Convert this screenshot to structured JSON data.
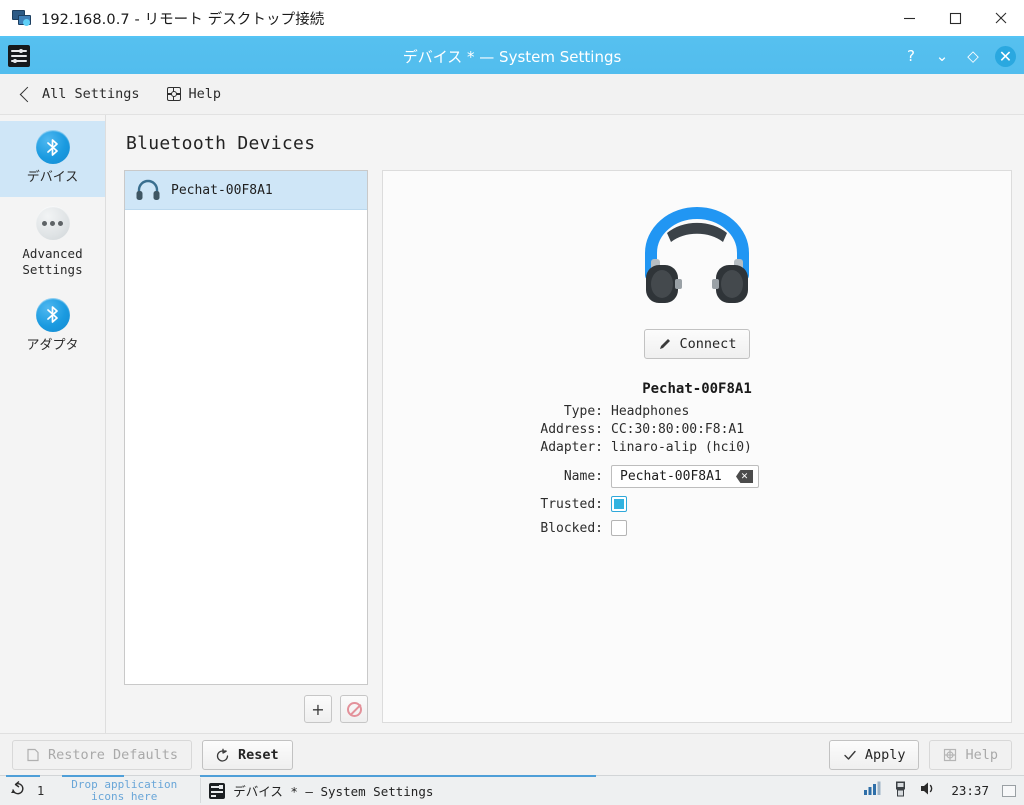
{
  "rdp": {
    "title": "192.168.0.7 - リモート デスクトップ接続",
    "icon": "remote-desktop-icon",
    "minimize": "minimize-button",
    "maximize": "maximize-button",
    "close": "close-button"
  },
  "kde_titlebar": {
    "title": "デバイス * — System Settings",
    "help_glyph": "?",
    "shade_glyph": "⌄",
    "keep_above_glyph": "◇",
    "close_glyph": "✕",
    "accent": "#52bdee"
  },
  "toolbar": {
    "back_label": "All Settings",
    "help_label": "Help"
  },
  "sidebar": {
    "items": [
      {
        "label": "デバイス",
        "icon": "bluetooth-icon",
        "active": true
      },
      {
        "label": "Advanced\nSettings",
        "label_line1": "Advanced",
        "label_line2": "Settings",
        "icon": "dots-icon",
        "active": false
      },
      {
        "label": "アダプタ",
        "icon": "bluetooth-icon",
        "active": false
      }
    ]
  },
  "main": {
    "page_title": "Bluetooth Devices",
    "device_list": [
      {
        "name": "Pechat-00F8A1",
        "icon": "headphones-icon",
        "selected": true
      }
    ],
    "list_actions": {
      "add_label": "+",
      "remove_label": "remove-device-icon"
    },
    "details": {
      "hero_icon": "headphones-icon",
      "connect_label": "Connect",
      "device_title": "Pechat-00F8A1",
      "fields": [
        {
          "key": "Type:",
          "value": "Headphones"
        },
        {
          "key": "Address:",
          "value": "CC:30:80:00:F8:A1"
        },
        {
          "key": "Adapter:",
          "value": "linaro-alip (hci0)"
        }
      ],
      "name_label": "Name:",
      "name_value": "Pechat-00F8A1",
      "name_placeholder": "Pechat-00F8A1",
      "clear_icon": "clear-text-icon",
      "trusted_label": "Trusted:",
      "trusted_checked": true,
      "blocked_label": "Blocked:",
      "blocked_checked": false,
      "checkbox_accent": "#30b3e0"
    }
  },
  "bottom_bar": {
    "restore_defaults_label": "Restore Defaults",
    "restore_defaults_enabled": false,
    "reset_label": "Reset",
    "apply_label": "Apply",
    "help_label": "Help",
    "help_enabled": false
  },
  "taskbar": {
    "pager_icon": "pager-icon",
    "desktop_number": "1",
    "drop_hint_line1": "Drop application",
    "drop_hint_line2": "icons here",
    "task_title": "デバイス * — System Settings",
    "tray": {
      "network_icon": "network-signal-icon",
      "device_icon": "usb-device-icon",
      "volume_icon": "volume-icon",
      "clock": "23:37",
      "show_desktop": "show-desktop-icon"
    }
  }
}
